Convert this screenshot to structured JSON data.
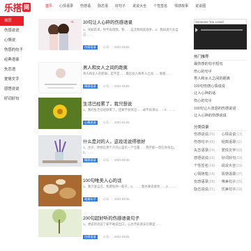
{
  "logo": {
    "text": "乐搭",
    "badge": "网"
  },
  "nav": [
    "首页",
    "心情语录",
    "伤感语",
    "励志语",
    "好句子",
    "说说大全",
    "个性签名",
    "情感故事",
    "说说图",
    "好歌词"
  ],
  "left": [
    "首页",
    "伤感说说",
    "心情说",
    "伤感的句子",
    "经典语录",
    "失恋语",
    "爱情文字",
    "感悟说说",
    "好词好句"
  ],
  "articles": [
    {
      "title": "30句让人心碎的伤感语录",
      "text": "1、突如其来，你不再理我，我……这次我彻底放手。2、我知道只有自己……",
      "tag": "伤感语录",
      "author": "小乐",
      "date": "2021-03-25",
      "reads": "阅读",
      "count": "评论"
    },
    {
      "title": "男人和女人之间的距离",
      "text": "男人和女人的距离，是不是……最近女人和男人之间……看看……",
      "tag": "情感语录",
      "author": "小乐",
      "date": "2021-03-25",
      "reads": "阅读",
      "count": "评论"
    },
    {
      "title": "生活已经累了，我只想说",
      "text": "1、我的生活已经够累了，还要学会哭泣……却不肯承认……2、……",
      "tag": "心情说说",
      "author": "小乐",
      "date": "2021-03-25",
      "reads": "阅读",
      "count": "评论"
    },
    {
      "title": "什么是对的人，这段话说得很好",
      "text": "1、也许，你想在那个人的心里有一个位置……我不能一直在你身边。2、……",
      "tag": "情感语录",
      "author": "小乐",
      "date": "2021-03-25",
      "reads": "阅读",
      "count": "评论"
    },
    {
      "title": "100句唯美入心的话",
      "text": "1、我只爱自己，我愿陪你一辈子。2、……我也要去爱你……3、……",
      "tag": "唯美句子",
      "author": "小乐",
      "date": "2021-03-25",
      "reads": "阅读",
      "count": "评论"
    },
    {
      "title": "200句超好听的伤感语录句子",
      "text": "1、想说的话说了却不敢说出口，心也不知道该在哪里……",
      "tag": "伤感语录",
      "author": "小乐",
      "date": "2021-03-25",
      "reads": "阅读",
      "count": "评论"
    }
  ],
  "player": {
    "name": "Someone You Loved"
  },
  "sidebar": {
    "hot_title": "热门推荐",
    "hot": [
      "最伤感的句子短句",
      "伤心的句子",
      "男人和女人之间的距离",
      "100句伤感心情说说",
      "让人心碎的话",
      "伤心的句子",
      "100句让人流泪的伤感说说",
      "让人心碎的伤感说说"
    ],
    "cat_title": "分类目录",
    "cats": [
      {
        "n": "伤感说说",
        "c": "(25)"
      },
      {
        "n": "心情说说",
        "c": "(13)"
      },
      {
        "n": "伤感句子",
        "c": "(42)"
      },
      {
        "n": "经典语录",
        "c": "(11)"
      },
      {
        "n": "失恋语录",
        "c": "(24)"
      },
      {
        "n": "爱情文字",
        "c": "(33)"
      },
      {
        "n": "感悟说说",
        "c": "(16)"
      },
      {
        "n": "好词好句",
        "c": "(19)"
      },
      {
        "n": "个性签名",
        "c": "(19)"
      },
      {
        "n": "说说大全",
        "c": "(31)"
      },
      {
        "n": "心情随笔",
        "c": "(14)"
      },
      {
        "n": "情感语录",
        "c": "(37)"
      },
      {
        "n": "伤感语录",
        "c": "(28)"
      },
      {
        "n": "唯美句子",
        "c": "(15)"
      },
      {
        "n": "励志说说",
        "c": "(21)"
      },
      {
        "n": "优美句子",
        "c": "(18)"
      }
    ]
  }
}
